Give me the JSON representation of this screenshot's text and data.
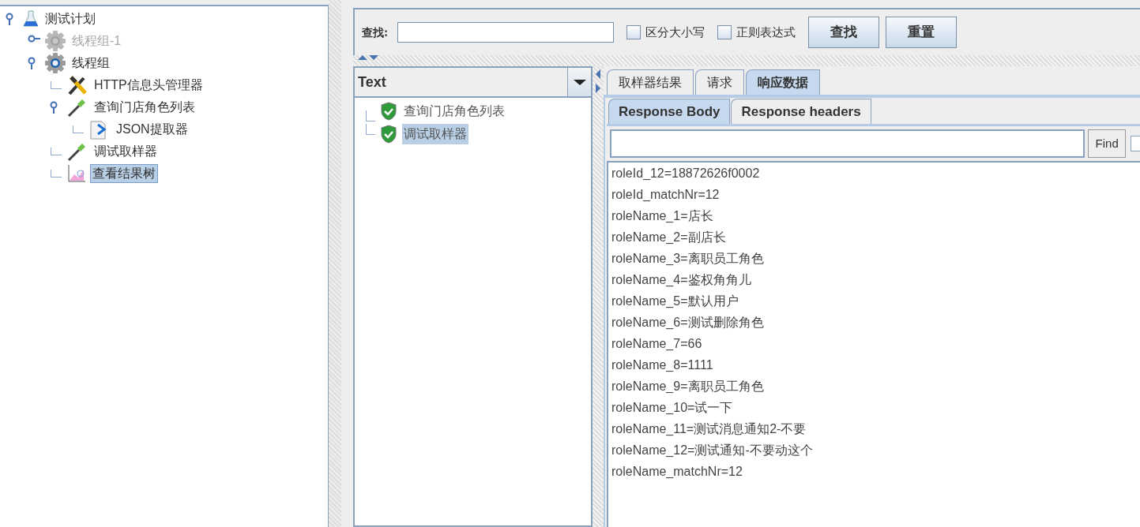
{
  "test_tree": [
    {
      "label": "测试计划",
      "kind": "plan",
      "disabled": false,
      "selected": false,
      "expanded": true,
      "children": [
        {
          "label": "线程组-1",
          "kind": "threads",
          "disabled": true,
          "selected": false,
          "expanded": false
        },
        {
          "label": "线程组",
          "kind": "threads",
          "disabled": false,
          "selected": false,
          "expanded": true,
          "children": [
            {
              "label": "HTTP信息头管理器",
              "kind": "config",
              "disabled": false,
              "selected": false
            },
            {
              "label": "查询门店角色列表",
              "kind": "sampler",
              "disabled": false,
              "selected": false,
              "expanded": true,
              "children": [
                {
                  "label": "JSON提取器",
                  "kind": "extractor",
                  "disabled": false,
                  "selected": false
                }
              ]
            },
            {
              "label": "调试取样器",
              "kind": "sampler",
              "disabled": false,
              "selected": false
            },
            {
              "label": "查看结果树",
              "kind": "listener",
              "disabled": false,
              "selected": true
            }
          ]
        }
      ]
    }
  ],
  "search_bar": {
    "label": "查找:",
    "options": [
      {
        "label": "区分大小写",
        "checked": false
      },
      {
        "label": "正则表达式",
        "checked": false
      }
    ],
    "buttons": [
      "查找",
      "重置"
    ]
  },
  "renderer": {
    "value": "Text"
  },
  "results": [
    {
      "label": "查询门店角色列表",
      "selected": false
    },
    {
      "label": "调试取样器",
      "selected": true
    }
  ],
  "tabs": [
    {
      "label": "取样器结果",
      "selected": false
    },
    {
      "label": "请求",
      "selected": false
    },
    {
      "label": "响应数据",
      "selected": true
    }
  ],
  "subtabs": [
    {
      "label": "Response Body",
      "selected": true
    },
    {
      "label": "Response headers",
      "selected": false
    }
  ],
  "find": {
    "button": "Find",
    "option_checked": false
  },
  "response_lines": [
    "roleId_12=18872626f0002",
    "roleId_matchNr=12",
    "roleName_1=店长",
    "roleName_2=副店长",
    "roleName_3=离职员工角色",
    "roleName_4=鉴权角角儿",
    "roleName_5=默认用户",
    "roleName_6=测试删除角色",
    "roleName_7=66",
    "roleName_8=1111",
    "roleName_9=离职员工角色",
    "roleName_10=试一下",
    "roleName_11=测试消息通知2-不要",
    "roleName_12=测试通知-不要动这个",
    "roleName_matchNr=12"
  ]
}
